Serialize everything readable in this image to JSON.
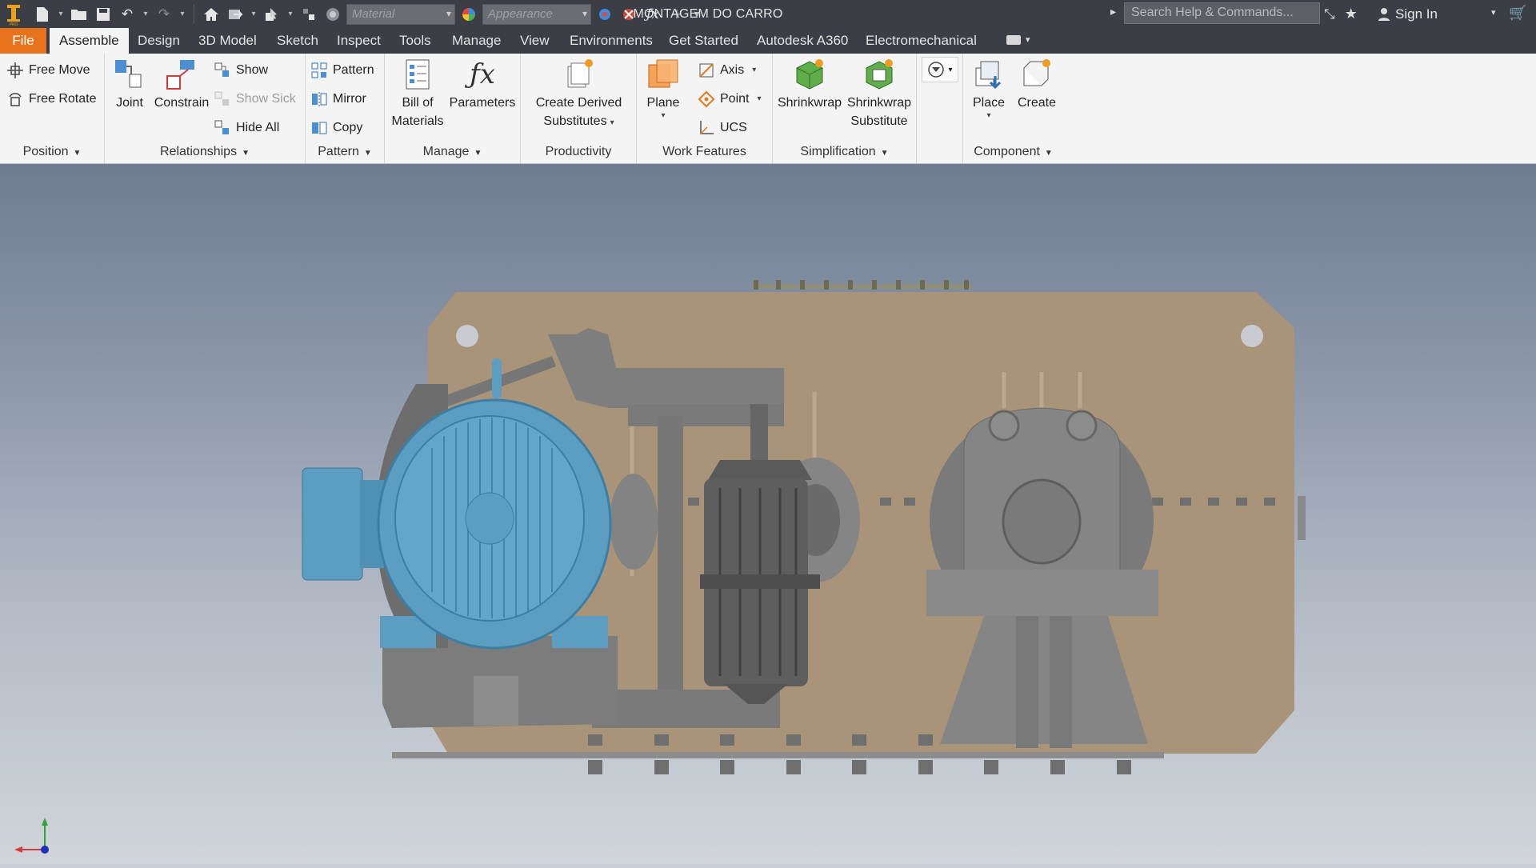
{
  "titlebar": {
    "doc_title": "MONTAGEM DO CARRO",
    "material_placeholder": "Material",
    "appearance_placeholder": "Appearance",
    "search_placeholder": "Search Help & Commands...",
    "sign_in": "Sign In"
  },
  "tabs": [
    "File",
    "Assemble",
    "Design",
    "3D Model",
    "Sketch",
    "Inspect",
    "Tools",
    "Manage",
    "View",
    "Environments",
    "Get Started",
    "Autodesk A360",
    "Electromechanical"
  ],
  "active_tab": "Assemble",
  "ribbon": {
    "position": {
      "label": "Position",
      "free_move": "Free Move",
      "free_rotate": "Free Rotate"
    },
    "relationships": {
      "label": "Relationships",
      "joint": "Joint",
      "constrain": "Constrain",
      "show": "Show",
      "show_sick": "Show Sick",
      "hide_all": "Hide All"
    },
    "pattern": {
      "label": "Pattern",
      "pattern": "Pattern",
      "mirror": "Mirror",
      "copy": "Copy"
    },
    "manage": {
      "label": "Manage",
      "bom_line1": "Bill of",
      "bom_line2": "Materials",
      "parameters": "Parameters"
    },
    "productivity": {
      "label": "Productivity",
      "cds_line1": "Create Derived",
      "cds_line2": "Substitutes"
    },
    "work_features": {
      "label": "Work Features",
      "plane": "Plane",
      "axis": "Axis",
      "point": "Point",
      "ucs": "UCS"
    },
    "simplification": {
      "label": "Simplification",
      "shrinkwrap": "Shrinkwrap",
      "sws_line1": "Shrinkwrap",
      "sws_line2": "Substitute"
    },
    "component": {
      "label": "Component",
      "place": "Place",
      "create": "Create"
    }
  },
  "colors": {
    "titlebar": "#3b3e44",
    "file_tab": "#e8731c",
    "ribbon": "#f4f4f4",
    "motor_blue": "#5b9ec1",
    "base_plate": "#a99479",
    "steel_gray": "#7d7d7d"
  },
  "icons": [
    "app-logo-icon",
    "new-icon",
    "open-icon",
    "save-icon",
    "undo-icon",
    "redo-icon",
    "home-icon",
    "return-icon",
    "select-filter-icon",
    "update-icon",
    "material-sphere-icon",
    "appearance-sphere-icon",
    "adjust-icon",
    "clear-icon",
    "fx-icon",
    "plus-icon",
    "customize-icon",
    "help-arrow-icon",
    "favorites-star-icon",
    "user-icon",
    "cart-icon",
    "view-cube-triad-icon"
  ]
}
